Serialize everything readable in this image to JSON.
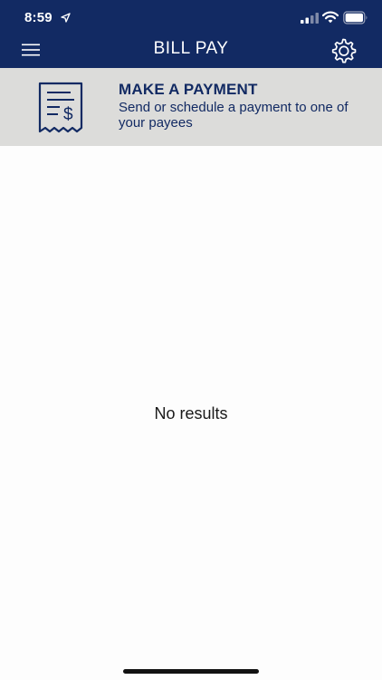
{
  "status_bar": {
    "time": "8:59"
  },
  "nav": {
    "title": "BILL PAY",
    "menu_icon": "hamburger-menu-icon",
    "settings_icon": "gear-icon"
  },
  "banner": {
    "title": "MAKE A PAYMENT",
    "subtitle": "Send or schedule a payment to one of your payees",
    "icon": "receipt-dollar-icon"
  },
  "content": {
    "empty_message": "No results"
  },
  "colors": {
    "brand_navy": "#122a63",
    "banner_gray": "#dcdcda"
  }
}
